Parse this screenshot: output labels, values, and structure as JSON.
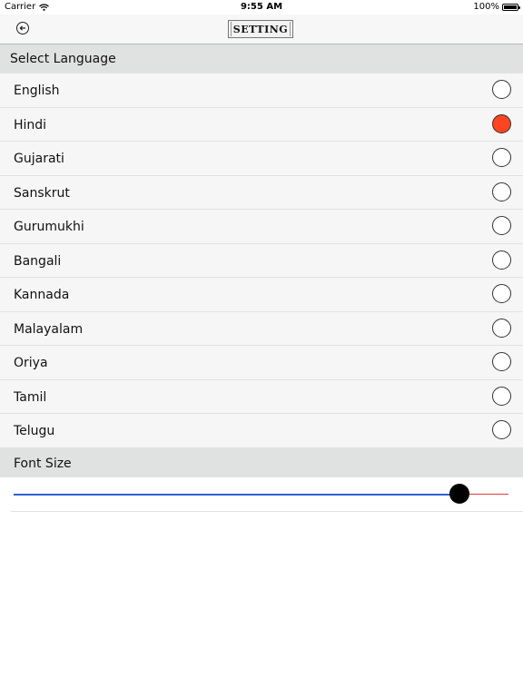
{
  "status": {
    "carrier": "Carrier",
    "time": "9:55 AM",
    "battery": "100%"
  },
  "nav": {
    "title": "SETTING",
    "back_icon": "back-arrow-circle-icon"
  },
  "language_section": {
    "header": "Select Language",
    "items": [
      {
        "label": "English",
        "selected": false
      },
      {
        "label": "Hindi",
        "selected": true
      },
      {
        "label": "Gujarati",
        "selected": false
      },
      {
        "label": "Sanskrut",
        "selected": false
      },
      {
        "label": "Gurumukhi",
        "selected": false
      },
      {
        "label": "Bangali",
        "selected": false
      },
      {
        "label": "Kannada",
        "selected": false
      },
      {
        "label": "Malayalam",
        "selected": false
      },
      {
        "label": "Oriya",
        "selected": false
      },
      {
        "label": "Tamil",
        "selected": false
      },
      {
        "label": "Telugu",
        "selected": false
      }
    ]
  },
  "font_section": {
    "header": "Font Size",
    "slider_value": 0.9
  },
  "colors": {
    "selected_radio": "#ff4422",
    "slider_min_track": "#2e5fd0",
    "slider_max_track": "#e03a3a"
  }
}
